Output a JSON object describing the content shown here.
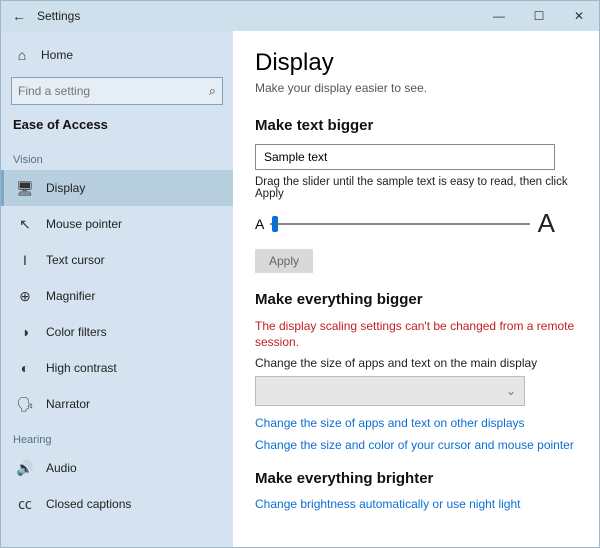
{
  "titlebar": {
    "title": "Settings",
    "minimize": "—",
    "maximize": "☐",
    "close": "✕",
    "back": "←"
  },
  "sidebar": {
    "home_label": "Home",
    "search_placeholder": "Find a setting",
    "section": "Ease of Access",
    "groups": [
      {
        "label": "Vision",
        "items": [
          {
            "icon": "🖥",
            "label": "Display",
            "active": true,
            "name": "sidebar-item-display"
          },
          {
            "icon": "↖",
            "label": "Mouse pointer",
            "name": "sidebar-item-mouse-pointer"
          },
          {
            "icon": "I",
            "label": "Text cursor",
            "name": "sidebar-item-text-cursor"
          },
          {
            "icon": "⊕",
            "label": "Magnifier",
            "name": "sidebar-item-magnifier"
          },
          {
            "icon": "◑",
            "label": "Color filters",
            "name": "sidebar-item-color-filters"
          },
          {
            "icon": "◐",
            "label": "High contrast",
            "name": "sidebar-item-high-contrast"
          },
          {
            "icon": "🗣",
            "label": "Narrator",
            "name": "sidebar-item-narrator"
          }
        ]
      },
      {
        "label": "Hearing",
        "items": [
          {
            "icon": "🔊",
            "label": "Audio",
            "name": "sidebar-item-audio"
          },
          {
            "icon": "㏄",
            "label": "Closed captions",
            "name": "sidebar-item-closed-captions"
          }
        ]
      }
    ]
  },
  "main": {
    "heading": "Display",
    "subtitle": "Make your display easier to see.",
    "section1": {
      "title": "Make text bigger",
      "sample": "Sample text",
      "hint": "Drag the slider until the sample text is easy to read, then click Apply",
      "smallA": "A",
      "bigA": "A",
      "apply": "Apply"
    },
    "section2": {
      "title": "Make everything bigger",
      "error": "The display scaling settings can't be changed from a remote session.",
      "desc": "Change the size of apps and text on the main display",
      "combo_chevron": "⌄",
      "link1": "Change the size of apps and text on other displays",
      "link2": "Change the size and color of your cursor and mouse pointer"
    },
    "section3": {
      "title": "Make everything brighter",
      "link1": "Change brightness automatically or use night light"
    }
  }
}
